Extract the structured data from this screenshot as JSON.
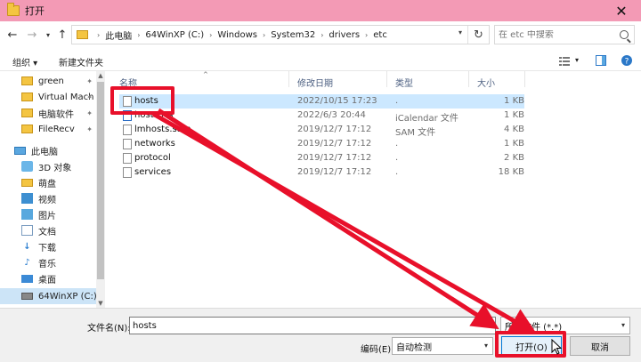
{
  "window": {
    "title": "打开",
    "close_glyph": "✕"
  },
  "nav": {
    "back_glyph": "←",
    "forward_glyph": "→",
    "recent_glyph": "▾",
    "up_glyph": "↑",
    "breadcrumbs": [
      "此电脑",
      "64WinXP (C:)",
      "Windows",
      "System32",
      "drivers",
      "etc"
    ],
    "refresh_glyph": "↻",
    "search_placeholder": "在 etc 中搜索"
  },
  "toolbar": {
    "organize_label": "组织 ▾",
    "new_folder_label": "新建文件夹"
  },
  "sidebar": {
    "items": [
      {
        "label": "green",
        "icon": "folder-icon",
        "pinned": true
      },
      {
        "label": "Virtual Mach",
        "icon": "folder-icon",
        "pinned": true
      },
      {
        "label": "电脑软件",
        "icon": "folder-icon",
        "pinned": true
      },
      {
        "label": "FileRecv",
        "icon": "folder-icon",
        "pinned": true
      },
      {
        "label": "此电脑",
        "icon": "computer-icon",
        "pinned": false
      },
      {
        "label": "3D 对象",
        "icon": "3d-objects-icon",
        "pinned": false
      },
      {
        "label": "萌盘",
        "icon": "folder-icon",
        "pinned": false
      },
      {
        "label": "视频",
        "icon": "video-icon",
        "pinned": false
      },
      {
        "label": "图片",
        "icon": "picture-icon",
        "pinned": false
      },
      {
        "label": "文档",
        "icon": "document-icon",
        "pinned": false
      },
      {
        "label": "下载",
        "icon": "download-icon",
        "pinned": false
      },
      {
        "label": "音乐",
        "icon": "music-icon",
        "pinned": false
      },
      {
        "label": "桌面",
        "icon": "desktop-icon",
        "pinned": false
      },
      {
        "label": "64WinXP (C:)",
        "icon": "drive-icon",
        "pinned": false
      }
    ],
    "pin_glyph": "📌"
  },
  "filelist": {
    "columns": [
      "名称",
      "修改日期",
      "类型",
      "大小"
    ],
    "rows": [
      {
        "name": "hosts",
        "date": "2022/10/15 17:23",
        "type": ".",
        "size": "1 KB",
        "selected": true
      },
      {
        "name": "hosts.ics",
        "date": "2022/6/3 20:44",
        "type": "iCalendar 文件",
        "size": "1 KB",
        "selected": false
      },
      {
        "name": "lmhosts.sam",
        "date": "2019/12/7 17:12",
        "type": "SAM 文件",
        "size": "4 KB",
        "selected": false
      },
      {
        "name": "networks",
        "date": "2019/12/7 17:12",
        "type": ".",
        "size": "1 KB",
        "selected": false
      },
      {
        "name": "protocol",
        "date": "2019/12/7 17:12",
        "type": ".",
        "size": "2 KB",
        "selected": false
      },
      {
        "name": "services",
        "date": "2019/12/7 17:12",
        "type": ".",
        "size": "18 KB",
        "selected": false
      }
    ]
  },
  "bottom": {
    "filename_label": "文件名(N):",
    "filename_value": "hosts",
    "filetype_value": "所有文件 (*.*)",
    "encoding_label": "编码(E):",
    "encoding_value": "自动检测",
    "open_label": "打开(O)",
    "cancel_label": "取消"
  },
  "colors": {
    "titlebar": "#f39ab5",
    "annotation": "#e8102a",
    "selection": "#cce8ff"
  }
}
